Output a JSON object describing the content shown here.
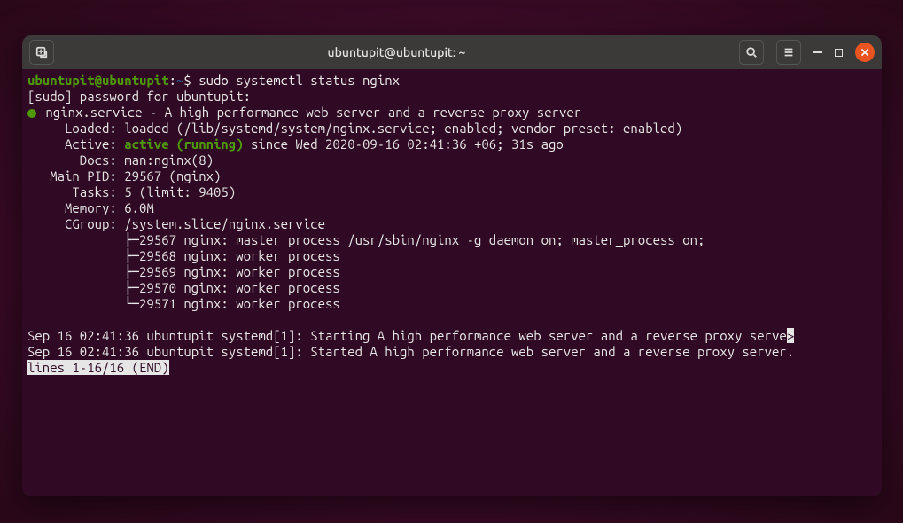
{
  "titlebar": {
    "title": "ubuntupit@ubuntupit: ~"
  },
  "prompt": {
    "user_host": "ubuntupit@ubuntupit",
    "sep": ":",
    "path": "~",
    "suffix": "$ ",
    "command": "sudo systemctl status nginx"
  },
  "sudo_line": "[sudo] password for ubuntupit:",
  "svc": {
    "name": " nginx.service - A high performance web server and a reverse proxy server",
    "loaded": "     Loaded: loaded (/lib/systemd/system/nginx.service; enabled; vendor preset: enabled)",
    "active_lbl": "     Active: ",
    "active_state": "active (running)",
    "active_rest": " since Wed 2020-09-16 02:41:36 +06; 31s ago",
    "docs": "       Docs: man:nginx(8)",
    "mainpid": "   Main PID: 29567 (nginx)",
    "tasks": "      Tasks: 5 (limit: 9405)",
    "memory": "     Memory: 6.0M",
    "cgroup": "     CGroup: /system.slice/nginx.service",
    "p1": "             ├─29567 nginx: master process /usr/sbin/nginx -g daemon on; master_process on;",
    "p2": "             ├─29568 nginx: worker process",
    "p3": "             ├─29569 nginx: worker process",
    "p4": "             ├─29570 nginx: worker process",
    "p5": "             └─29571 nginx: worker process"
  },
  "log1a": "Sep 16 02:41:36 ubuntupit systemd[1]: Starting A high performance web server and a reverse proxy serve",
  "log1b": ">",
  "log2": "Sep 16 02:41:36 ubuntupit systemd[1]: Started A high performance web server and a reverse proxy server.",
  "pager": "lines 1-16/16 (END)"
}
